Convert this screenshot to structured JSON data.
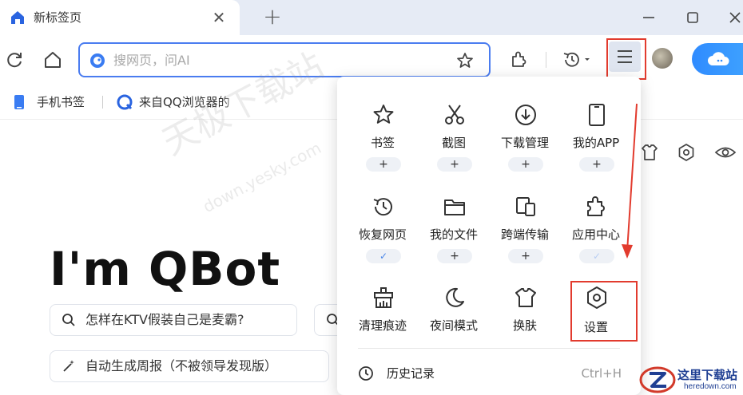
{
  "tab": {
    "title": "新标签页"
  },
  "toolbar": {
    "address_placeholder": "搜网页，问AI"
  },
  "bookmarks": [
    {
      "label": "手机书签"
    },
    {
      "label": "来自QQ浏览器的"
    }
  ],
  "page": {
    "title": "I'm QBot",
    "suggestions": [
      {
        "label": "怎样在KTV假装自己是麦霸?"
      },
      {
        "label": "自动生成周报（不被领导发现版）"
      }
    ]
  },
  "menu": {
    "grid": [
      {
        "label": "书签",
        "icon": "star-icon",
        "state": "+"
      },
      {
        "label": "截图",
        "icon": "scissors-icon",
        "state": "+"
      },
      {
        "label": "下载管理",
        "icon": "download-icon",
        "state": "+"
      },
      {
        "label": "我的APP",
        "icon": "phone-icon",
        "state": "+"
      },
      {
        "label": "恢复网页",
        "icon": "restore-icon",
        "state": "✓"
      },
      {
        "label": "我的文件",
        "icon": "folder-icon",
        "state": "+"
      },
      {
        "label": "跨端传输",
        "icon": "transfer-icon",
        "state": "+"
      },
      {
        "label": "应用中心",
        "icon": "puzzle-icon",
        "state": "✓"
      },
      {
        "label": "清理痕迹",
        "icon": "broom-icon",
        "state": ""
      },
      {
        "label": "夜间模式",
        "icon": "moon-icon",
        "state": ""
      },
      {
        "label": "换肤",
        "icon": "shirt-icon",
        "state": ""
      },
      {
        "label": "设置",
        "icon": "settings-icon",
        "state": ""
      }
    ],
    "history": {
      "label": "历史记录",
      "shortcut": "Ctrl+H"
    }
  },
  "watermark": {
    "text": "天极下载站",
    "url": "down.yesky.com"
  },
  "site_logo": {
    "cn": "这里下载站",
    "en": "heredown.com"
  },
  "colors": {
    "accent": "#4a7cf0",
    "annotation": "#e23b2e"
  }
}
